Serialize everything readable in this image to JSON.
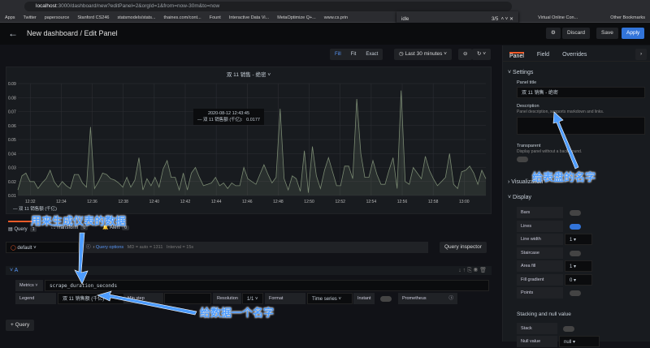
{
  "browser": {
    "url_host": "localhost",
    "url_rest": ":3000/dashboard/new?editPanel=2&orgId=1&from=now-30m&to=now",
    "bookmarks": [
      "Apps",
      "Twitter",
      "papersource",
      "Stanford CS246",
      "statsmodels/stats...",
      "thaines.com/cont...",
      "Fount",
      "Interactive Data Vi...",
      "MetaOptimize Q+...",
      "www.cs.prin"
    ],
    "bookmarks_right": [
      "Virtual Online Con...",
      "Other Bookmarks"
    ],
    "find": {
      "query": "idle",
      "count": "3/5"
    }
  },
  "header": {
    "title": "New dashboard / Edit Panel",
    "discard": "Discard",
    "save": "Save",
    "apply": "Apply"
  },
  "toolbar": {
    "fill": "Fill",
    "fit": "Fit",
    "exact": "Exact",
    "time_range": "Last 30 minutes"
  },
  "panel": {
    "title": "双 11 销售 - 绝密",
    "legend": "双 11 销售额 (千亿)",
    "tooltip": {
      "time": "2020-08-12 12:43:45",
      "series": "双 11 销售额 (千亿):",
      "value": "0.0177"
    }
  },
  "chart_data": {
    "type": "area",
    "title": "双 11 销售 - 绝密",
    "ylim": [
      0.01,
      0.09
    ],
    "yticks": [
      "0.09",
      "0.08",
      "0.07",
      "0.06",
      "0.05",
      "0.04",
      "0.03",
      "0.02",
      "0.01"
    ],
    "xticks": [
      "12:32",
      "12:34",
      "12:36",
      "12:38",
      "12:40",
      "12:42",
      "12:44",
      "12:46",
      "12:48",
      "12:50",
      "12:52",
      "12:54",
      "12:56",
      "12:58",
      "13:00"
    ],
    "x_start_min": -0.8,
    "x_end_min": 29.4,
    "series": [
      {
        "name": "双 11 销售额 (千亿)",
        "color": "#7a8a72",
        "values": [
          0.014,
          0.024,
          0.026,
          0.02,
          0.02,
          0.015,
          0.019,
          0.022,
          0.028,
          0.02,
          0.016,
          0.02,
          0.017,
          0.015,
          0.025,
          0.025,
          0.019,
          0.016,
          0.059,
          0.015,
          0.02,
          0.026,
          0.025,
          0.022,
          0.021,
          0.019,
          0.016,
          0.023,
          0.016,
          0.021,
          0.037,
          0.014,
          0.022,
          0.017,
          0.023,
          0.016,
          0.029,
          0.035,
          0.023,
          0.023,
          0.014,
          0.026,
          0.014,
          0.026,
          0.03,
          0.023,
          0.017,
          0.018,
          0.019,
          0.023,
          0.017,
          0.019,
          0.015,
          0.019,
          0.017,
          0.017,
          0.03,
          0.022,
          0.02,
          0.018,
          0.025,
          0.032,
          0.025,
          0.019,
          0.023,
          0.072,
          0.022,
          0.014,
          0.024,
          0.022,
          0.013,
          0.042,
          0.012,
          0.045,
          0.024,
          0.015,
          0.028,
          0.037,
          0.027,
          0.017,
          0.017,
          0.031,
          0.031,
          0.022,
          0.079,
          0.04,
          0.023,
          0.023,
          0.035,
          0.025,
          0.018,
          0.018,
          0.028,
          0.037,
          0.015,
          0.085,
          0.02,
          0.018,
          0.03,
          0.026,
          0.022,
          0.038,
          0.028,
          0.022,
          0.017,
          0.02,
          0.023,
          0.04,
          0.018,
          0.015,
          0.027,
          0.028,
          0.031,
          0.026,
          0.018,
          0.028,
          0.022
        ]
      }
    ]
  },
  "tabs": {
    "query": "Query",
    "query_count": "1",
    "transform": "Transform",
    "transform_count": "0",
    "alert": "Alert",
    "alert_count": "0"
  },
  "query": {
    "datasource": "default",
    "options": "Query options",
    "md": "MD = auto = 1311",
    "interval": "Interval = 15s",
    "inspector": "Query inspector",
    "ref": "A",
    "metrics_label": "Metrics",
    "metrics": "scrape_duration_seconds",
    "legend_label": "Legend",
    "legend": "双 11 销售额 (千亿)",
    "min_step": "Min step",
    "resolution_label": "Resolution",
    "resolution": "1/1",
    "format_label": "Format",
    "format": "Time series",
    "instant": "Instant",
    "prometheus": "Prometheus",
    "add": "+ Query"
  },
  "side": {
    "tabs": [
      "Panel",
      "Field",
      "Overrides"
    ],
    "settings": "Settings",
    "panel_title_label": "Panel title",
    "panel_title": "双 11 销售 - 绝密",
    "description_label": "Description",
    "description_hint": "Panel description, supports markdown and links.",
    "transparent_label": "Transparent",
    "transparent_hint": "Display panel without a background.",
    "visualization": "Visualization",
    "display": "Display",
    "rows": [
      {
        "label": "Bars",
        "type": "toggle",
        "on": false
      },
      {
        "label": "Lines",
        "type": "toggle",
        "on": true
      },
      {
        "label": "Line width",
        "type": "select",
        "value": "1"
      },
      {
        "label": "Staircase",
        "type": "toggle",
        "on": false
      },
      {
        "label": "Area fill",
        "type": "select",
        "value": "1"
      },
      {
        "label": "Fill gradient",
        "type": "select",
        "value": "0"
      },
      {
        "label": "Points",
        "type": "toggle",
        "on": false
      }
    ],
    "stacking": "Stacking and null value",
    "stack": "Stack",
    "null_value": "Null value",
    "null_value_val": "null"
  },
  "annotations": {
    "data": "用来生成仪表的数据",
    "legend": "给数据一个名字",
    "title": "给表盘的名字"
  }
}
